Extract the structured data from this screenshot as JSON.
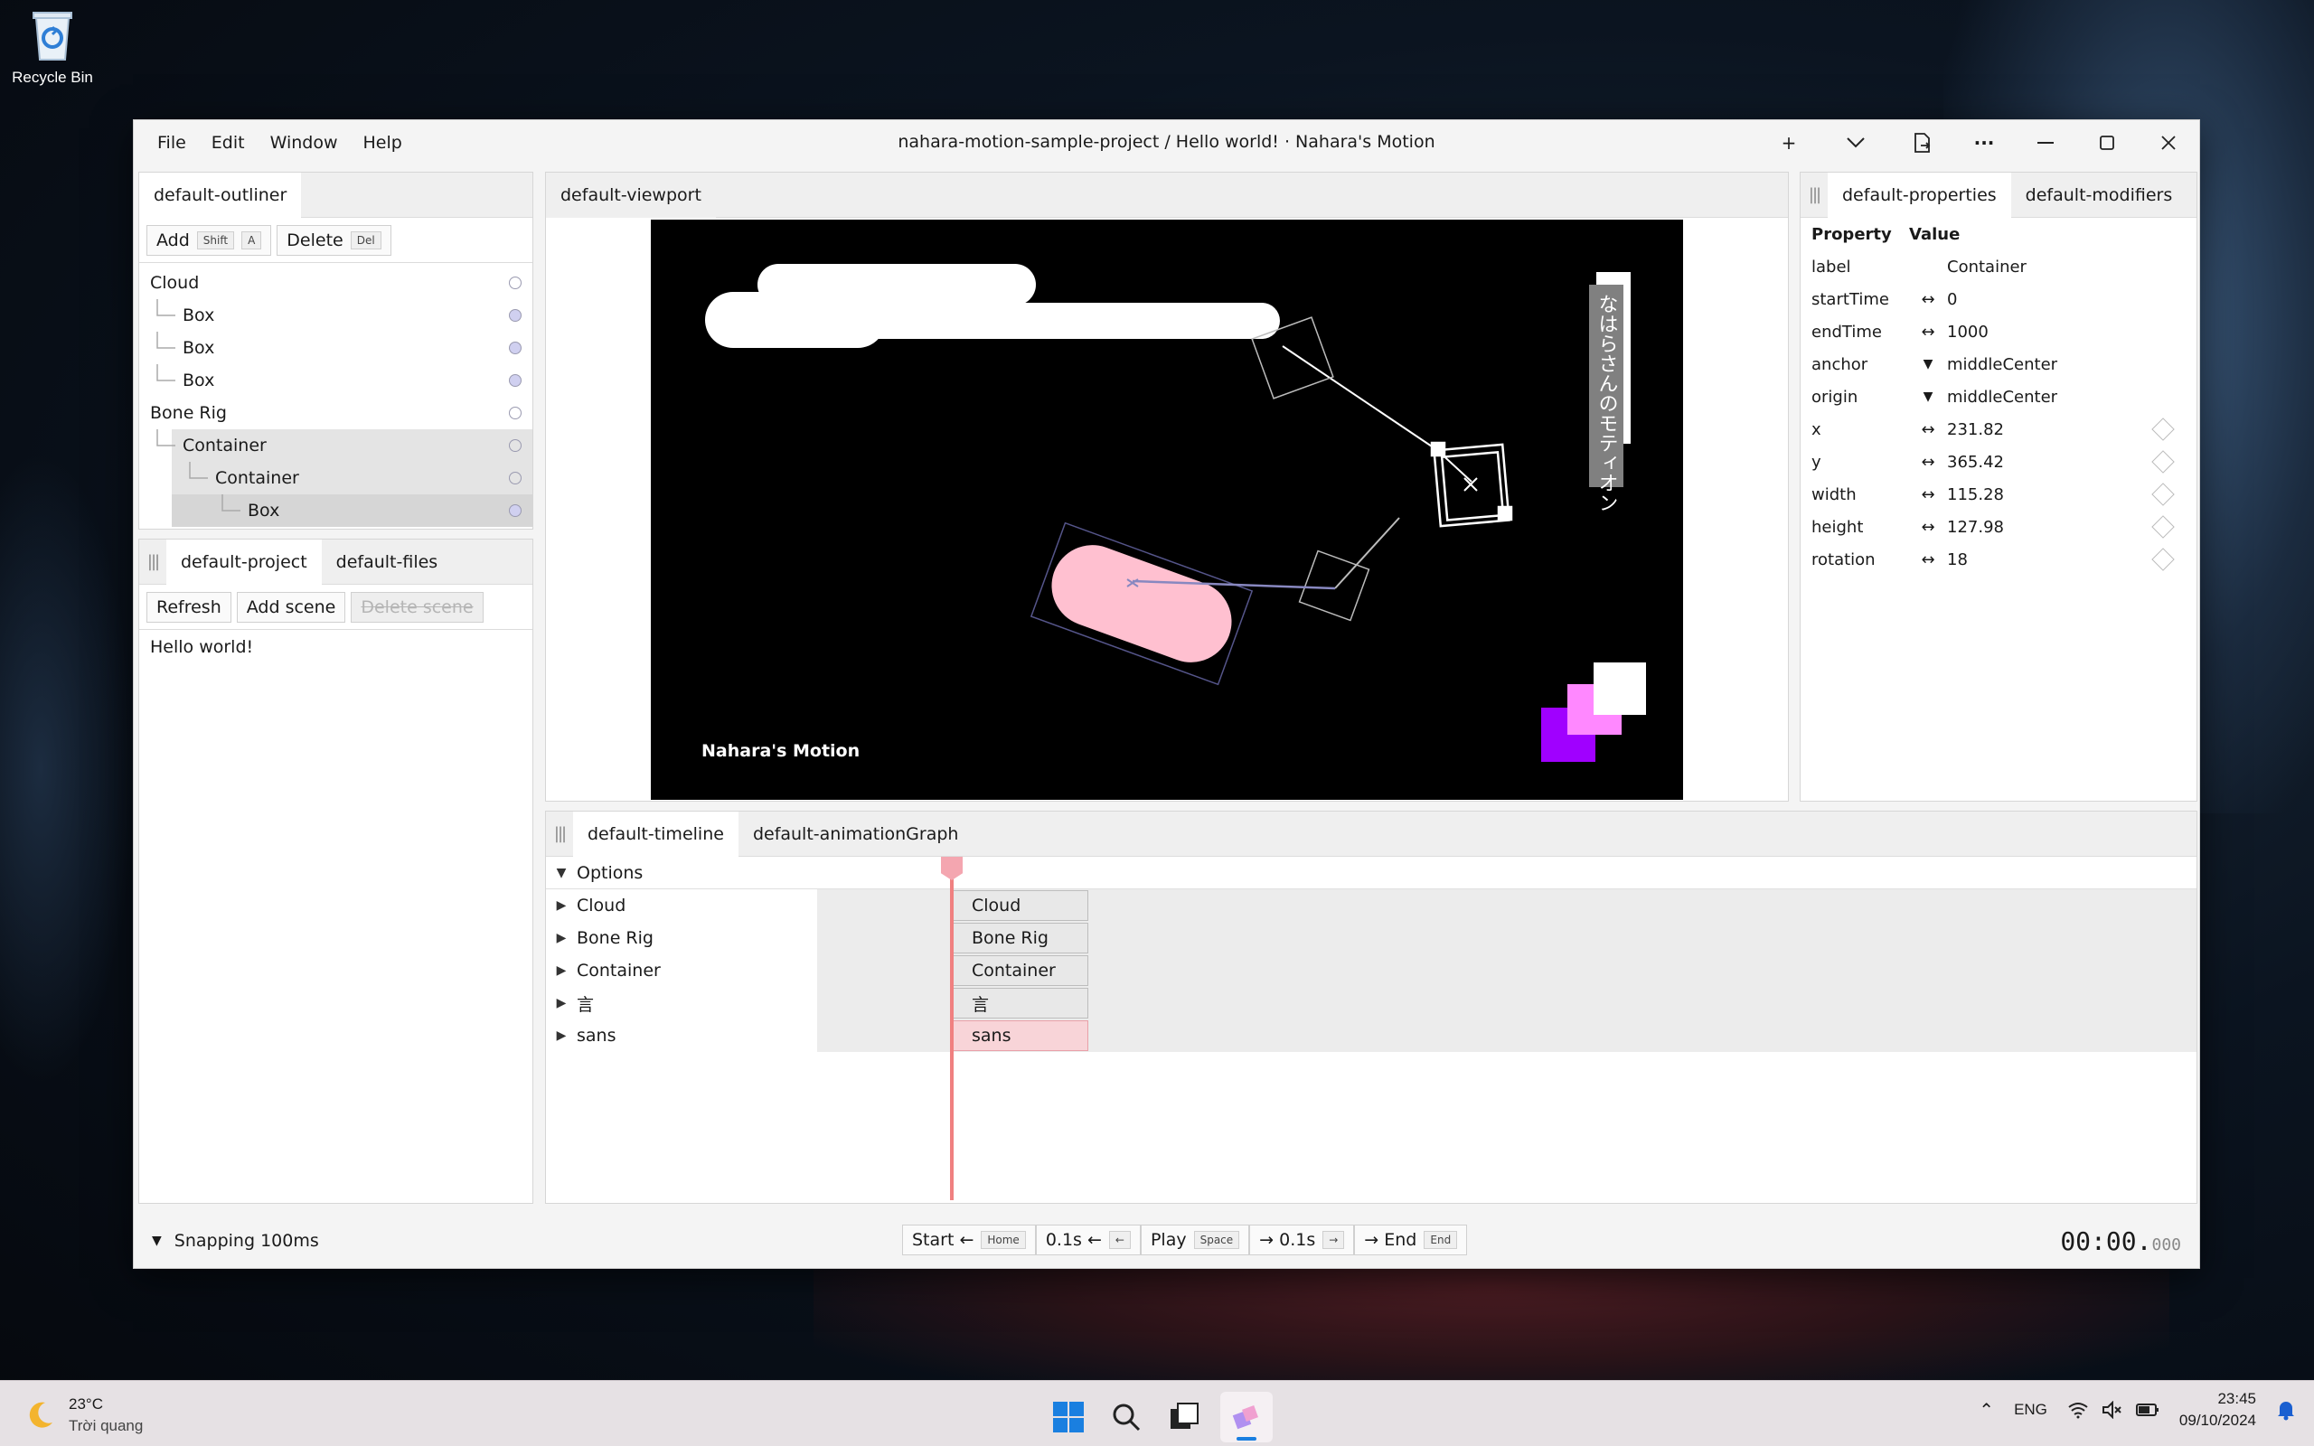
{
  "desktop": {
    "recycle_bin_label": "Recycle Bin"
  },
  "window": {
    "title": "nahara-motion-sample-project / Hello world! · Nahara's Motion",
    "menu": [
      "File",
      "Edit",
      "Window",
      "Help"
    ],
    "controls": {
      "plus": "+",
      "chevron": "⌄",
      "more": "···",
      "minimize": "—",
      "maximize": "☐",
      "close": "✕"
    }
  },
  "outliner": {
    "tab": "default-outliner",
    "add_label": "Add",
    "add_keys": [
      "Shift",
      "A"
    ],
    "delete_label": "Delete",
    "delete_key": "Del",
    "items": [
      {
        "label": "Cloud",
        "depth": 0
      },
      {
        "label": "Box",
        "depth": 1
      },
      {
        "label": "Box",
        "depth": 1
      },
      {
        "label": "Box",
        "depth": 1
      },
      {
        "label": "Bone Rig",
        "depth": 0
      },
      {
        "label": "Container",
        "depth": 1
      },
      {
        "label": "Container",
        "depth": 2
      },
      {
        "label": "Box",
        "depth": 3
      }
    ]
  },
  "project": {
    "tabs": [
      "default-project",
      "default-files"
    ],
    "refresh_label": "Refresh",
    "add_scene_label": "Add scene",
    "delete_scene_label": "Delete scene",
    "scenes": [
      "Hello world!"
    ]
  },
  "viewport": {
    "tab": "default-viewport",
    "watermark": "Nahara's Motion",
    "vertical_text": "なはらさんのモティオン"
  },
  "properties": {
    "tabs": [
      "default-properties",
      "default-modifiers"
    ],
    "header_property": "Property",
    "header_value": "Value",
    "rows": [
      {
        "key": "label",
        "icon": "",
        "value": "Container",
        "keyframe": false
      },
      {
        "key": "startTime",
        "icon": "↔",
        "value": "0",
        "keyframe": false
      },
      {
        "key": "endTime",
        "icon": "↔",
        "value": "1000",
        "keyframe": false
      },
      {
        "key": "anchor",
        "icon": "▼",
        "value": "middleCenter",
        "keyframe": false
      },
      {
        "key": "origin",
        "icon": "▼",
        "value": "middleCenter",
        "keyframe": false
      },
      {
        "key": "x",
        "icon": "↔",
        "value": "231.82",
        "keyframe": true
      },
      {
        "key": "y",
        "icon": "↔",
        "value": "365.42",
        "keyframe": true
      },
      {
        "key": "width",
        "icon": "↔",
        "value": "115.28",
        "keyframe": true
      },
      {
        "key": "height",
        "icon": "↔",
        "value": "127.98",
        "keyframe": true
      },
      {
        "key": "rotation",
        "icon": "↔",
        "value": "18",
        "keyframe": true
      }
    ]
  },
  "timeline": {
    "tabs": [
      "default-timeline",
      "default-animationGraph"
    ],
    "options_label": "Options",
    "tracks": [
      {
        "label": "Cloud",
        "clip": "Cloud"
      },
      {
        "label": "Bone Rig",
        "clip": "Bone Rig"
      },
      {
        "label": "Container",
        "clip": "Container"
      },
      {
        "label": "言",
        "clip": "言"
      },
      {
        "label": "sans",
        "clip": "sans"
      }
    ]
  },
  "footer": {
    "snapping_label": "Snapping 100ms",
    "transport": [
      {
        "label": "Start ←",
        "key": "Home"
      },
      {
        "label": "0.1s ←",
        "key": "←"
      },
      {
        "label": "Play",
        "key": "Space"
      },
      {
        "label": "→ 0.1s",
        "key": "→"
      },
      {
        "label": "→ End",
        "key": "End"
      }
    ],
    "time_main": "00:00.",
    "time_ms": "000"
  },
  "taskbar": {
    "weather_temp": "23°C",
    "weather_desc": "Trời quang",
    "lang": "ENG",
    "time": "23:45",
    "date": "09/10/2024"
  },
  "colors": {
    "accent_pink": "#f4a6b0",
    "playhead": "#f08080",
    "viewport_bg": "#000000",
    "capsule_fill": "#ffc0d0"
  }
}
